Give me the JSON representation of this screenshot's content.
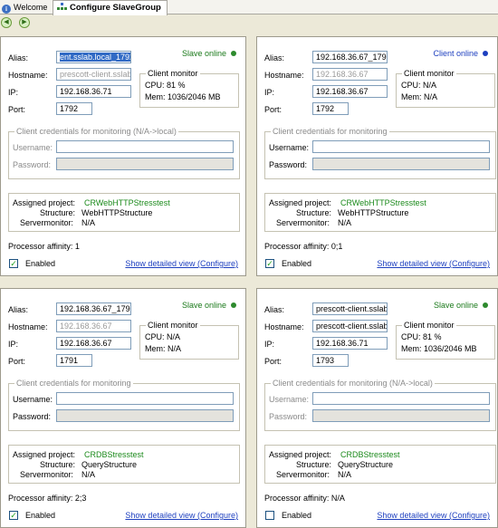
{
  "tabs": {
    "welcome": "Welcome",
    "active": "Configure SlaveGroup"
  },
  "labels": {
    "alias": "Alias:",
    "hostname": "Hostname:",
    "ip": "IP:",
    "port": "Port:",
    "client_monitor": "Client monitor",
    "username": "Username:",
    "password": "Password:",
    "assigned_project": "Assigned project:",
    "structure": "Structure:",
    "servermonitor": "Servermonitor:",
    "enabled": "Enabled",
    "show_details": "Show detailed view (Configure)"
  },
  "colors": {
    "online_green": "#1b7a1b",
    "online_blue": "#1d3fbf",
    "project_green": "#1b8a1b"
  },
  "panels": [
    {
      "alias": "ent.sslab.local_1792",
      "hostname": "prescott-client.sslab",
      "ip": "192.168.36.71",
      "port": "1792",
      "status": "Slave online",
      "cpu": "CPU: 81 %",
      "mem": "Mem: 1036/2046 MB",
      "cred_title": "Client credentials for monitoring (N/A->local)",
      "username": "",
      "password": "",
      "project": "CRWebHTTPStresstest",
      "structure": "WebHTTPStructure",
      "servermonitor": "N/A",
      "affinity": "Processor affinity: 1",
      "enabled": true
    },
    {
      "alias": "192.168.36.67_179",
      "hostname": "192.168.36.67",
      "ip": "192.168.36.67",
      "port": "1792",
      "status": "Client online",
      "cpu": "CPU: N/A",
      "mem": "Mem: N/A",
      "cred_title": "Client credentials for monitoring",
      "username": "",
      "password": "",
      "project": "CRWebHTTPStresstest",
      "structure": "WebHTTPStructure",
      "servermonitor": "N/A",
      "affinity": "Processor affinity: 0;1",
      "enabled": true
    },
    {
      "alias": "192.168.36.67_179",
      "hostname": "192.168.36.67",
      "ip": "192.168.36.67",
      "port": "1791",
      "status": "Slave online",
      "cpu": "CPU: N/A",
      "mem": "Mem: N/A",
      "cred_title": "Client credentials for monitoring",
      "username": "",
      "password": "",
      "project": "CRDBStresstest",
      "structure": "QueryStructure",
      "servermonitor": "N/A",
      "affinity": "Processor affinity: 2;3",
      "enabled": true
    },
    {
      "alias": "prescott-client.sslab",
      "hostname": "prescott-client.sslab",
      "ip": "192.168.36.71",
      "port": "1793",
      "status": "Slave online",
      "cpu": "CPU: 81 %",
      "mem": "Mem: 1036/2046 MB",
      "cred_title": "Client credentials for monitoring (N/A->local)",
      "username": "",
      "password": "",
      "project": "CRDBStresstest",
      "structure": "QueryStructure",
      "servermonitor": "N/A",
      "affinity": "Processor affinity: N/A",
      "enabled": false
    }
  ]
}
